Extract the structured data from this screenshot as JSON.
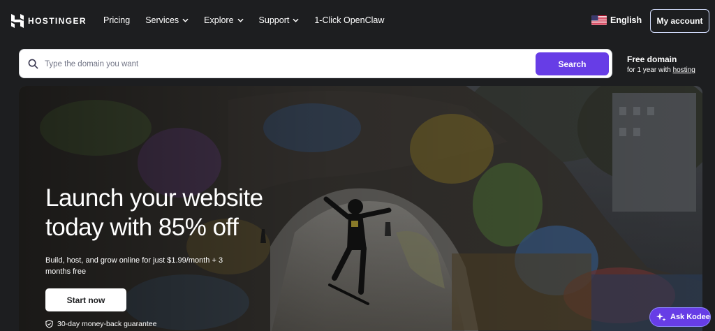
{
  "brand": {
    "name": "HOSTINGER"
  },
  "nav": {
    "links": [
      {
        "label": "Pricing",
        "dropdown": false
      },
      {
        "label": "Services",
        "dropdown": true
      },
      {
        "label": "Explore",
        "dropdown": true
      },
      {
        "label": "Support",
        "dropdown": true
      },
      {
        "label": "1-Click OpenClaw",
        "dropdown": false
      }
    ],
    "language": "English",
    "account_label": "My account"
  },
  "search": {
    "placeholder": "Type the domain you want",
    "button_label": "Search"
  },
  "free_domain": {
    "title": "Free domain",
    "sub_prefix": "for 1 year with",
    "sub_link": "hosting"
  },
  "hero": {
    "title_line1": "Launch your website",
    "title_line2": "today with 85% off",
    "subtitle": "Build, host, and grow online for just $1.99/month + 3 months free",
    "cta_label": "Start now",
    "guarantee": "30-day money-back guarantee"
  },
  "chat": {
    "label": "Ask Kodee"
  },
  "colors": {
    "accent": "#673de6",
    "background": "#1d1e20",
    "text": "#ffffff"
  },
  "icons": {
    "logo": "hostinger-logo-icon",
    "chevron": "chevron-down-icon",
    "flag": "us-flag-icon",
    "search": "search-icon",
    "guarantee": "shield-check-icon",
    "chat": "sparkle-icon"
  }
}
